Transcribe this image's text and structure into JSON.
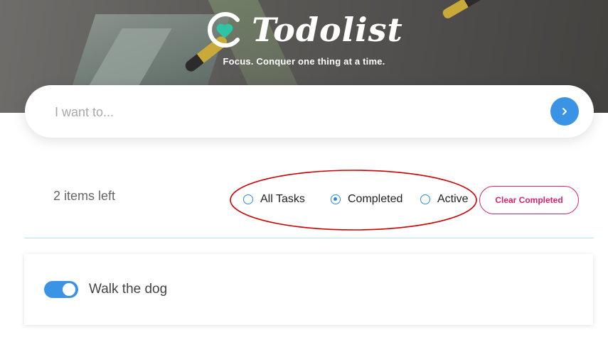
{
  "header": {
    "app_name": "Todolist",
    "tagline": "Focus. Conquer one thing at a time.",
    "logo_icon": "todolist-heart-logo-icon"
  },
  "input": {
    "placeholder": "I want to...",
    "value": "",
    "submit_icon": "chevron-right-icon"
  },
  "filters": {
    "items_left": "2 items left",
    "options": [
      {
        "label": "All Tasks",
        "selected": false
      },
      {
        "label": "Completed",
        "selected": true
      },
      {
        "label": "Active",
        "selected": false
      }
    ],
    "clear_label": "Clear Completed",
    "highlight_color": "#cc0000"
  },
  "tasks": [
    {
      "label": "Walk the dog",
      "completed": true
    }
  ],
  "colors": {
    "accent": "#3b93e6",
    "danger": "#d8236e",
    "divider": "#b6e2e8"
  }
}
